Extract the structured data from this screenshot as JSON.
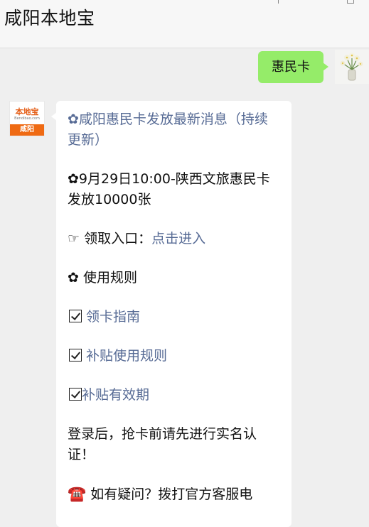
{
  "header": {
    "title": "咸阳本地宝"
  },
  "outgoing": {
    "text": "惠民卡"
  },
  "incoming_avatar": {
    "logo": "本地宝",
    "url": "Bendibao.com",
    "city": "咸阳"
  },
  "message": {
    "line1": "✿咸阳惠民卡发放最新消息（持续更新）",
    "line2": "✿9月29日10:00-陕西文旅惠民卡发放10000张",
    "entry_prefix": "☞ 领取入口：",
    "entry_link": "点击进入",
    "rules_heading": "✿ 使用规则",
    "links": [
      "领卡指南",
      "补贴使用规则",
      "补贴有效期"
    ],
    "notice": "登录后，抢卡前请先进行实名认证！",
    "phone_icon": "☎️",
    "contact": "如有疑问？拨打官方客服电"
  }
}
